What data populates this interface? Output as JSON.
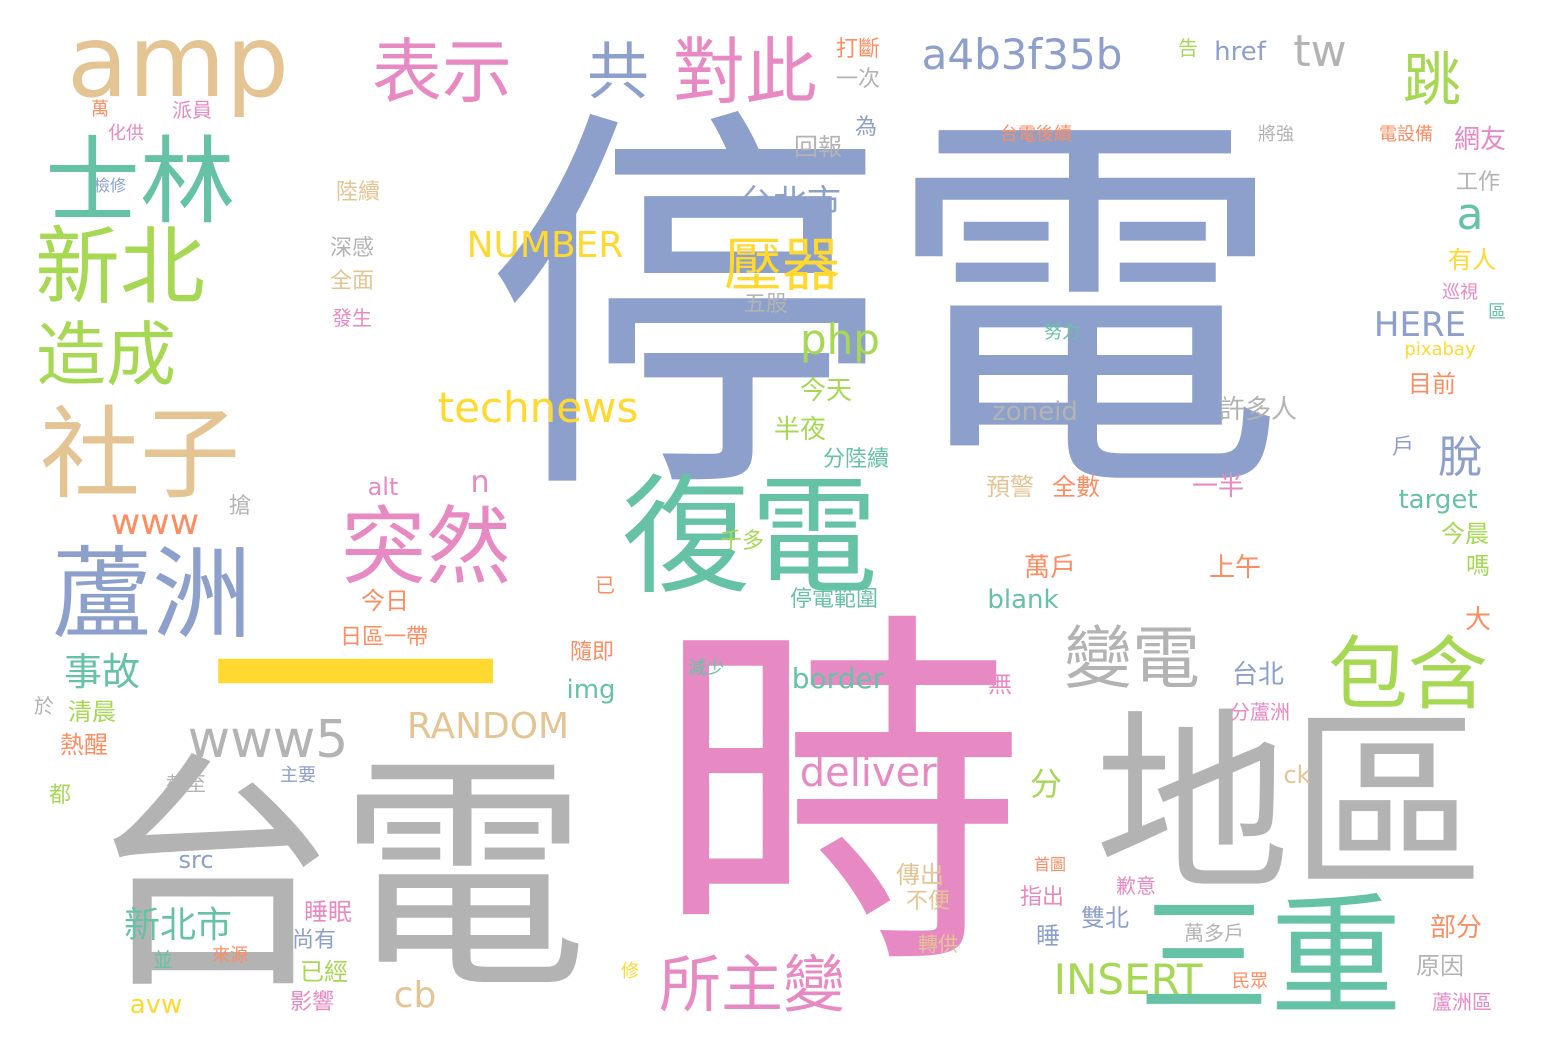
{
  "palette": {
    "blue": "#8da0cb",
    "pink": "#e78ac3",
    "gray": "#b3b3b3",
    "teal": "#66c2a5",
    "green": "#a6d854",
    "tan": "#e5c494",
    "orange": "#fc8d62",
    "yellow": "#ffd92f"
  },
  "words": [
    {
      "text": "停電",
      "color": "blue"
    },
    {
      "text": "時",
      "color": "pink"
    },
    {
      "text": "台電",
      "color": "gray"
    },
    {
      "text": "地區",
      "color": "gray"
    },
    {
      "text": "一",
      "color": "yellow"
    },
    {
      "text": "三重",
      "color": "teal"
    },
    {
      "text": "復電",
      "color": "teal"
    },
    {
      "text": "amp",
      "color": "tan"
    },
    {
      "text": "士林",
      "color": "teal"
    },
    {
      "text": "新北",
      "color": "green"
    },
    {
      "text": "社子",
      "color": "tan"
    },
    {
      "text": "蘆洲",
      "color": "blue"
    },
    {
      "text": "造成",
      "color": "green"
    },
    {
      "text": "表示",
      "color": "pink"
    },
    {
      "text": "共",
      "color": "blue"
    },
    {
      "text": "對此",
      "color": "pink"
    },
    {
      "text": "a4b3f35b",
      "color": "blue"
    },
    {
      "text": "tw",
      "color": "gray"
    },
    {
      "text": "跳",
      "color": "green"
    },
    {
      "text": "突然",
      "color": "pink"
    },
    {
      "text": "包含",
      "color": "green"
    },
    {
      "text": "變電",
      "color": "gray"
    },
    {
      "text": "www5",
      "color": "gray"
    },
    {
      "text": "所主變",
      "color": "pink"
    },
    {
      "text": "壓器",
      "color": "yellow"
    },
    {
      "text": "technews",
      "color": "yellow"
    },
    {
      "text": "NUMBER",
      "color": "yellow"
    },
    {
      "text": "RANDOM",
      "color": "tan"
    },
    {
      "text": "delivery",
      "color": "pink"
    },
    {
      "text": "INSERT",
      "color": "green"
    },
    {
      "text": "php",
      "color": "green"
    },
    {
      "text": "HERE",
      "color": "blue"
    },
    {
      "text": "脫",
      "color": "blue"
    },
    {
      "text": "台北市",
      "color": "blue"
    },
    {
      "text": "a",
      "color": "teal"
    },
    {
      "text": "www",
      "color": "orange"
    },
    {
      "text": "事故",
      "color": "teal"
    },
    {
      "text": "新北市",
      "color": "teal"
    },
    {
      "text": "cb",
      "color": "tan"
    },
    {
      "text": "n",
      "color": "pink"
    },
    {
      "text": "zoneid",
      "color": "gray"
    },
    {
      "text": "許多人",
      "color": "gray"
    },
    {
      "text": "預警",
      "color": "tan"
    },
    {
      "text": "全數",
      "color": "orange"
    },
    {
      "text": "一半",
      "color": "pink"
    },
    {
      "text": "target",
      "color": "teal"
    },
    {
      "text": "blank",
      "color": "teal"
    },
    {
      "text": "border",
      "color": "teal"
    },
    {
      "text": "img",
      "color": "teal"
    },
    {
      "text": "台北",
      "color": "blue"
    },
    {
      "text": "分",
      "color": "green"
    },
    {
      "text": "萬戶",
      "color": "orange"
    },
    {
      "text": "上午",
      "color": "orange"
    },
    {
      "text": "回報",
      "color": "gray"
    },
    {
      "text": "打斷",
      "color": "orange"
    },
    {
      "text": "一次",
      "color": "gray"
    },
    {
      "text": "href",
      "color": "blue"
    },
    {
      "text": "告",
      "color": "green"
    },
    {
      "text": "為",
      "color": "blue"
    },
    {
      "text": "網友",
      "color": "pink"
    },
    {
      "text": "工作",
      "color": "gray"
    },
    {
      "text": "有人",
      "color": "yellow"
    },
    {
      "text": "目前",
      "color": "orange"
    },
    {
      "text": "今天",
      "color": "green"
    },
    {
      "text": "半夜",
      "color": "green"
    },
    {
      "text": "分陸續",
      "color": "teal"
    },
    {
      "text": "千多",
      "color": "green"
    },
    {
      "text": "今日",
      "color": "orange"
    },
    {
      "text": "日區一帶",
      "color": "orange"
    },
    {
      "text": "停電範圍",
      "color": "teal"
    },
    {
      "text": "alt",
      "color": "pink"
    },
    {
      "text": "清晨",
      "color": "green"
    },
    {
      "text": "熱醒",
      "color": "orange"
    },
    {
      "text": "陸續",
      "color": "tan"
    },
    {
      "text": "深感",
      "color": "gray"
    },
    {
      "text": "全面",
      "color": "tan"
    },
    {
      "text": "發生",
      "color": "pink"
    },
    {
      "text": "五股",
      "color": "gray"
    },
    {
      "text": "努力",
      "color": "teal"
    },
    {
      "text": "巡視",
      "color": "pink"
    },
    {
      "text": "區",
      "color": "teal"
    },
    {
      "text": "pixabay",
      "color": "yellow"
    },
    {
      "text": "台電後續",
      "color": "orange"
    },
    {
      "text": "將強",
      "color": "gray"
    },
    {
      "text": "電設備",
      "color": "orange"
    },
    {
      "text": "萬",
      "color": "orange"
    },
    {
      "text": "派員",
      "color": "pink"
    },
    {
      "text": "化供",
      "color": "pink"
    },
    {
      "text": "檢修",
      "color": "blue"
    },
    {
      "text": "搶",
      "color": "gray"
    },
    {
      "text": "已",
      "color": "orange"
    },
    {
      "text": "隨即",
      "color": "orange"
    },
    {
      "text": "減少",
      "color": "teal"
    },
    {
      "text": "無",
      "color": "pink"
    },
    {
      "text": "分蘆洲",
      "color": "pink"
    },
    {
      "text": "於",
      "color": "gray"
    },
    {
      "text": "都",
      "color": "green"
    },
    {
      "text": "截至",
      "color": "gray"
    },
    {
      "text": "主要",
      "color": "blue"
    },
    {
      "text": "ck",
      "color": "tan"
    },
    {
      "text": "src",
      "color": "blue"
    },
    {
      "text": "傳出",
      "color": "tan"
    },
    {
      "text": "不便",
      "color": "tan"
    },
    {
      "text": "首圖",
      "color": "orange"
    },
    {
      "text": "指出",
      "color": "pink"
    },
    {
      "text": "歉意",
      "color": "pink"
    },
    {
      "text": "雙北",
      "color": "blue"
    },
    {
      "text": "睡",
      "color": "blue"
    },
    {
      "text": "萬多戶",
      "color": "gray"
    },
    {
      "text": "部分",
      "color": "orange"
    },
    {
      "text": "原因",
      "color": "gray"
    },
    {
      "text": "民眾",
      "color": "orange"
    },
    {
      "text": "蘆洲區",
      "color": "pink"
    },
    {
      "text": "轉供",
      "color": "tan"
    },
    {
      "text": "睡眠",
      "color": "pink"
    },
    {
      "text": "尚有",
      "color": "blue"
    },
    {
      "text": "已經",
      "color": "green"
    },
    {
      "text": "影響",
      "color": "pink"
    },
    {
      "text": "修",
      "color": "yellow"
    },
    {
      "text": "並",
      "color": "teal"
    },
    {
      "text": "來源",
      "color": "orange"
    },
    {
      "text": "avw",
      "color": "yellow"
    },
    {
      "text": "今晨",
      "color": "green"
    },
    {
      "text": "嗎",
      "color": "green"
    },
    {
      "text": "大",
      "color": "orange"
    },
    {
      "text": "戶",
      "color": "blue"
    }
  ]
}
